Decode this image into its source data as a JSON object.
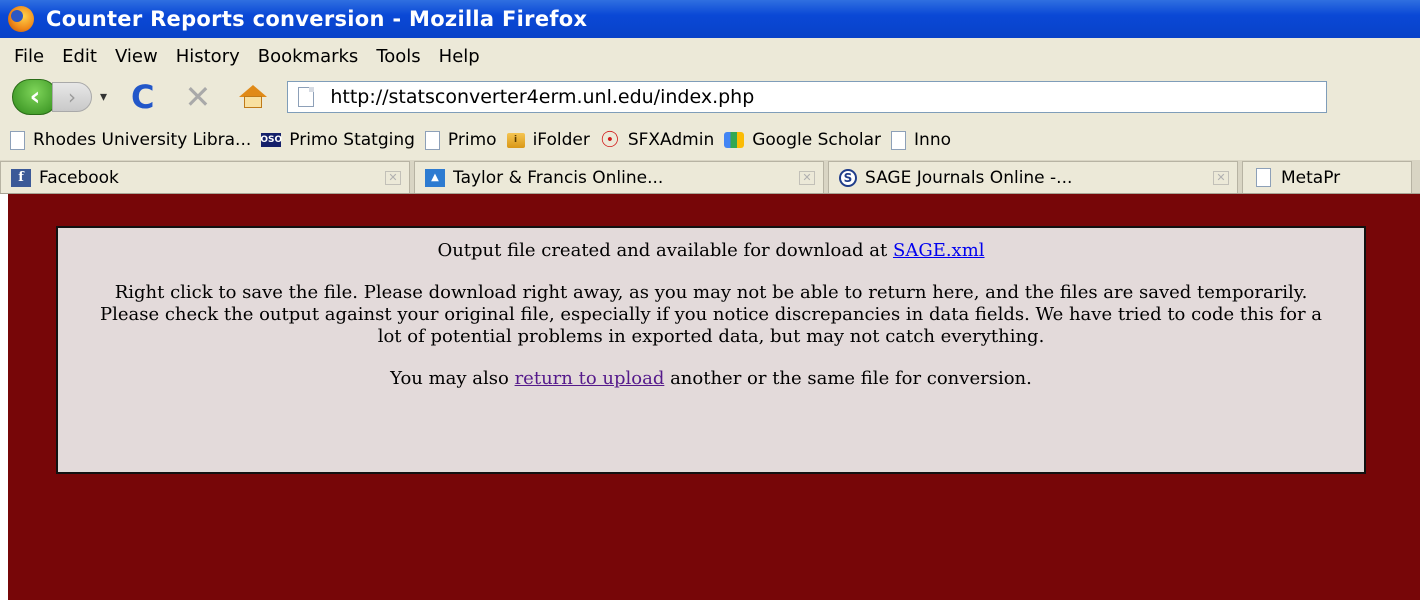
{
  "window": {
    "title": "Counter Reports conversion - Mozilla Firefox"
  },
  "menu": {
    "items": [
      "File",
      "Edit",
      "View",
      "History",
      "Bookmarks",
      "Tools",
      "Help"
    ]
  },
  "navigation": {
    "url": "http://statsconverter4erm.unl.edu/index.php",
    "icons": [
      "back-icon",
      "forward-icon",
      "dropdown-icon",
      "reload-icon",
      "stop-icon",
      "home-icon",
      "page-icon"
    ]
  },
  "bookmarks": {
    "items": [
      {
        "label": "Rhodes University Libra...",
        "icon": "page-icon"
      },
      {
        "label": "Primo Statging",
        "icon": "oso-icon"
      },
      {
        "label": "Primo",
        "icon": "page-icon"
      },
      {
        "label": "iFolder",
        "icon": "folder-icon"
      },
      {
        "label": "SFXAdmin",
        "icon": "sfx-icon"
      },
      {
        "label": "Google Scholar",
        "icon": "google-scholar-icon"
      },
      {
        "label": "Inno",
        "icon": "page-icon"
      }
    ]
  },
  "tabs": {
    "items": [
      {
        "label": "Facebook",
        "icon": "facebook-icon"
      },
      {
        "label": "Taylor & Francis Online...",
        "icon": "taylor-francis-icon"
      },
      {
        "label": "SAGE Journals Online -...",
        "icon": "sage-icon"
      },
      {
        "label": "MetaPr",
        "icon": "page-icon"
      }
    ]
  },
  "content": {
    "line1_prefix": "Output file created and available for download at ",
    "download_link": "SAGE.xml",
    "instructions_line1": "Right click to save the file. Please download right away, as you may not be able to return here, and the files are saved temporarily.",
    "instructions_line2": "Please check the output against your original file, especially if you notice discrepancies in data fields. We have tried to code this for a lot of potential problems in exported data, but may not catch everything.",
    "return_prefix": "You may also ",
    "return_link": "return to upload",
    "return_suffix": " another or the same file for conversion."
  },
  "colors": {
    "page_background": "#770608",
    "panel_background": "#e3dada",
    "link": "#0000ee",
    "visited_link": "#551a8b"
  }
}
